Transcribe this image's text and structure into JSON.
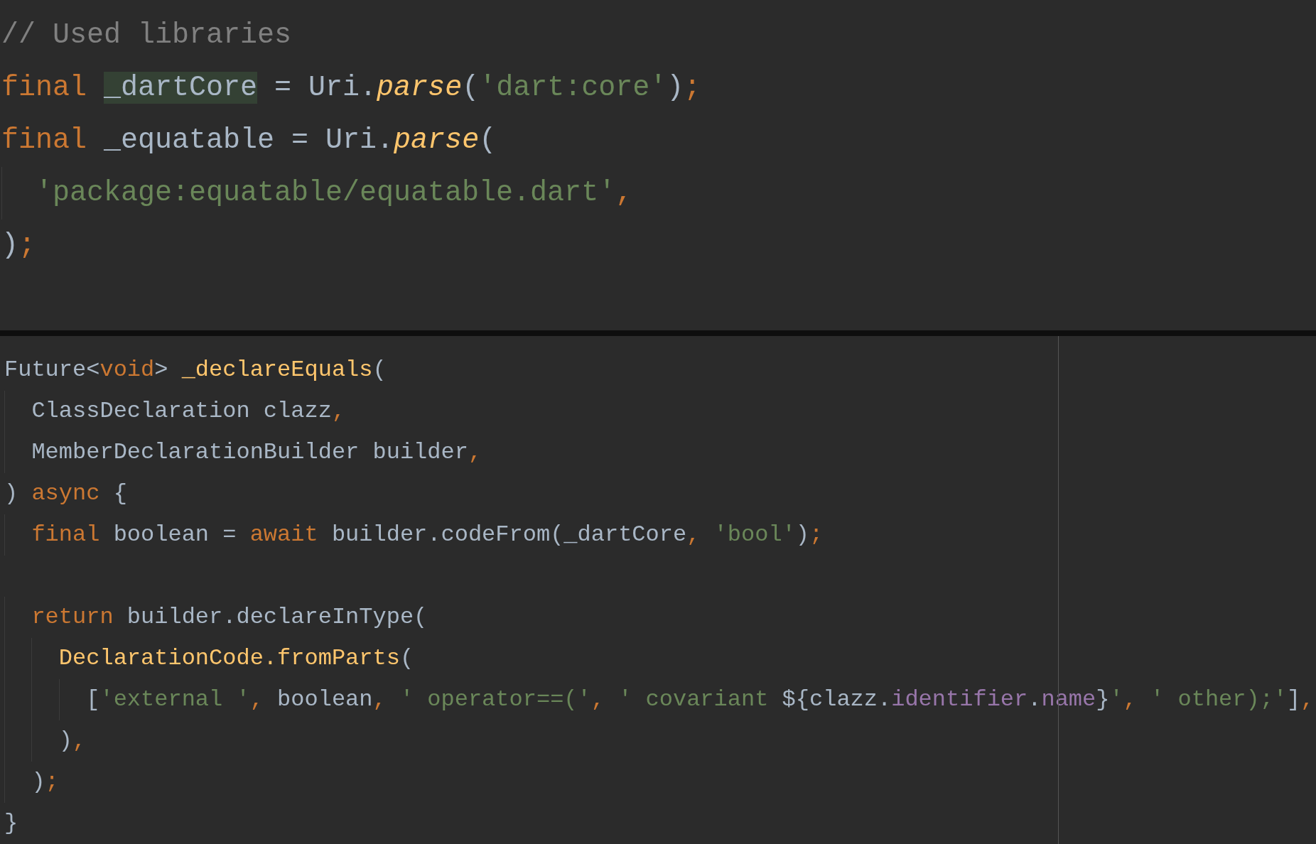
{
  "panes": [
    {
      "kind": "large",
      "lines": [
        {
          "kind": "code",
          "tokens": [
            {
              "kind": "comment",
              "t": "// Used libraries"
            }
          ]
        },
        {
          "kind": "code",
          "tokens": [
            {
              "kind": "keyword",
              "t": "final "
            },
            {
              "kind": "plain",
              "t": "_dartCore",
              "highlighted": true
            },
            {
              "kind": "plain",
              "t": " = Uri."
            },
            {
              "kind": "call",
              "t": "parse"
            },
            {
              "kind": "plain",
              "t": "("
            },
            {
              "kind": "string",
              "t": "'dart:core'"
            },
            {
              "kind": "plain",
              "t": ")"
            },
            {
              "kind": "keyword",
              "t": ";"
            }
          ]
        },
        {
          "kind": "code",
          "tokens": [
            {
              "kind": "keyword",
              "t": "final"
            },
            {
              "kind": "plain",
              "t": " _equatable = Uri."
            },
            {
              "kind": "call",
              "t": "parse"
            },
            {
              "kind": "plain",
              "t": "("
            }
          ]
        },
        {
          "kind": "code",
          "tokens": [
            {
              "kind": "string",
              "t": "  'package:equatable/equatable.dart'"
            },
            {
              "kind": "keyword",
              "t": ","
            }
          ]
        },
        {
          "kind": "code",
          "tokens": [
            {
              "kind": "plain",
              "t": ")"
            },
            {
              "kind": "keyword",
              "t": ";"
            }
          ]
        }
      ]
    },
    {
      "kind": "small",
      "lines": [
        {
          "kind": "code",
          "tokens": [
            {
              "kind": "plain",
              "t": "Future<"
            },
            {
              "kind": "keyword",
              "t": "void"
            },
            {
              "kind": "plain",
              "t": "> "
            },
            {
              "kind": "decl",
              "t": "_declareEquals"
            },
            {
              "kind": "plain",
              "t": "("
            }
          ]
        },
        {
          "kind": "code",
          "tokens": [
            {
              "kind": "plain",
              "t": "  ClassDeclaration clazz"
            },
            {
              "kind": "keyword",
              "t": ","
            }
          ]
        },
        {
          "kind": "code",
          "tokens": [
            {
              "kind": "plain",
              "t": "  MemberDeclarationBuilder builder"
            },
            {
              "kind": "keyword",
              "t": ","
            }
          ]
        },
        {
          "kind": "code",
          "tokens": [
            {
              "kind": "plain",
              "t": ") "
            },
            {
              "kind": "keyword",
              "t": "async"
            },
            {
              "kind": "plain",
              "t": " {"
            }
          ]
        },
        {
          "kind": "code",
          "tokens": [
            {
              "kind": "keyword",
              "t": "  final"
            },
            {
              "kind": "plain",
              "t": " boolean = "
            },
            {
              "kind": "keyword",
              "t": "await"
            },
            {
              "kind": "plain",
              "t": " builder.codeFrom(_dartCore"
            },
            {
              "kind": "keyword",
              "t": ", "
            },
            {
              "kind": "string",
              "t": "'bool'"
            },
            {
              "kind": "plain",
              "t": ")"
            },
            {
              "kind": "keyword",
              "t": ";"
            }
          ]
        },
        {
          "kind": "blank"
        },
        {
          "kind": "code",
          "tokens": [
            {
              "kind": "keyword",
              "t": "  return"
            },
            {
              "kind": "plain",
              "t": " builder.declareInType("
            }
          ]
        },
        {
          "kind": "code",
          "tokens": [
            {
              "kind": "decl",
              "t": "    DeclarationCode.fromParts"
            },
            {
              "kind": "plain",
              "t": "("
            }
          ]
        },
        {
          "kind": "code",
          "tokens": [
            {
              "kind": "plain",
              "t": "      ["
            },
            {
              "kind": "string",
              "t": "'external '"
            },
            {
              "kind": "keyword",
              "t": ","
            },
            {
              "kind": "plain",
              "t": " boolean"
            },
            {
              "kind": "keyword",
              "t": ", "
            },
            {
              "kind": "string",
              "t": "' operator==('"
            },
            {
              "kind": "keyword",
              "t": ", "
            },
            {
              "kind": "string",
              "t": "' covariant "
            },
            {
              "kind": "plain",
              "t": "${clazz."
            },
            {
              "kind": "field",
              "t": "identifier"
            },
            {
              "kind": "plain",
              "t": "."
            },
            {
              "kind": "field",
              "t": "name"
            },
            {
              "kind": "plain",
              "t": "}"
            },
            {
              "kind": "string",
              "t": "'"
            },
            {
              "kind": "keyword",
              "t": ", "
            },
            {
              "kind": "string",
              "t": "' other);'"
            },
            {
              "kind": "plain",
              "t": "]"
            },
            {
              "kind": "keyword",
              "t": ","
            }
          ]
        },
        {
          "kind": "code",
          "tokens": [
            {
              "kind": "plain",
              "t": "    )"
            },
            {
              "kind": "keyword",
              "t": ","
            }
          ]
        },
        {
          "kind": "code",
          "tokens": [
            {
              "kind": "plain",
              "t": "  )"
            },
            {
              "kind": "keyword",
              "t": ";"
            }
          ]
        },
        {
          "kind": "code",
          "tokens": [
            {
              "kind": "plain",
              "t": "}"
            }
          ]
        }
      ]
    }
  ]
}
